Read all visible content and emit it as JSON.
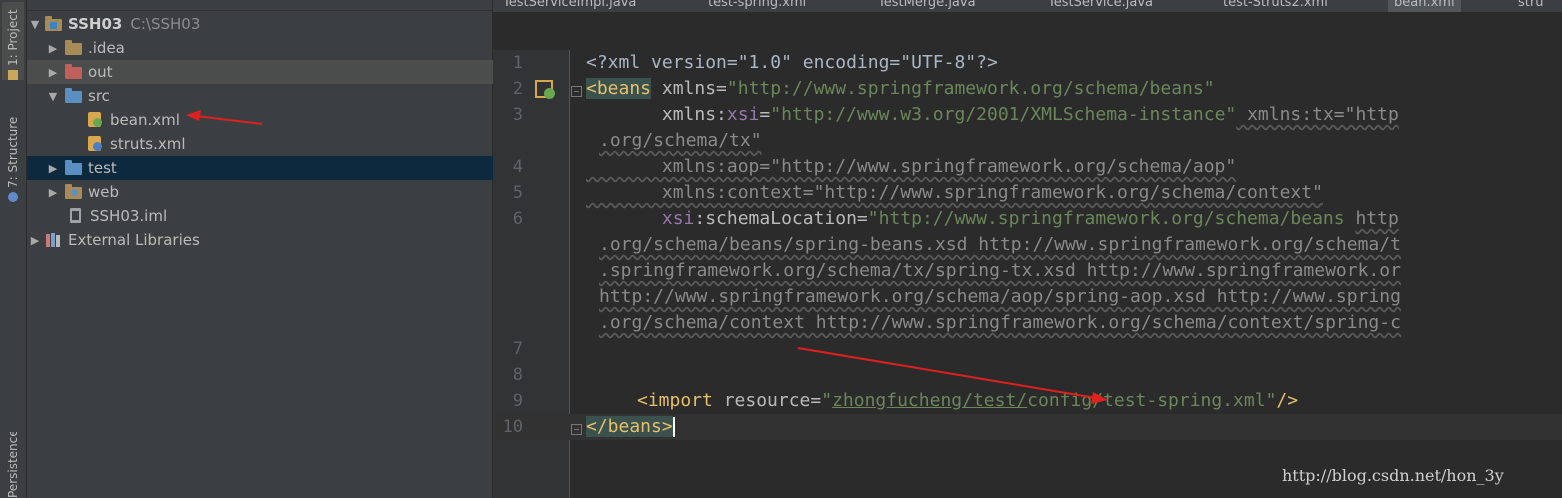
{
  "side_tabs": {
    "project": "1: Project",
    "structure": "7: Structure",
    "persistence": "Persistence"
  },
  "project_tree": [
    {
      "label": "SSH03",
      "path": "C:\\SSH03",
      "icon": "module-folder-icon",
      "expanded": true
    },
    {
      "label": ".idea",
      "icon": "folder-icon"
    },
    {
      "label": "out",
      "icon": "excluded-folder-icon"
    },
    {
      "label": "src",
      "icon": "source-folder-icon",
      "expanded": true
    },
    {
      "label": "bean.xml",
      "icon": "spring-xml-icon"
    },
    {
      "label": "struts.xml",
      "icon": "struts-xml-icon"
    },
    {
      "label": "test",
      "icon": "test-folder-icon"
    },
    {
      "label": "web",
      "icon": "web-folder-icon"
    },
    {
      "label": "SSH03.iml",
      "icon": "iml-file-icon"
    },
    {
      "label": "External Libraries",
      "icon": "libraries-icon"
    }
  ],
  "editor_tabs": [
    "TestServiceImpl.java",
    "test-spring.xml",
    "TestMerge.java",
    "TestService.java",
    "test-Struts2.xml",
    "bean.xml",
    "stru"
  ],
  "line_numbers": [
    "1",
    "2",
    "3",
    "4",
    "5",
    "6",
    "7",
    "8",
    "9",
    "10"
  ],
  "code": {
    "l1": "<?xml version=\"1.0\" encoding=\"UTF-8\"?>",
    "l2_tag": "<beans",
    "l2_attr": " xmlns=",
    "l2_val": "\"http://www.springframework.org/schema/beans\"",
    "l3_indent": "       xmlns:",
    "l3_ns": "xsi",
    "l3_eq": "=",
    "l3_val": "\"http://www.w3.org/2001/XMLSchema-instance\"",
    "l3_rest": " xmlns:tx=\"http",
    "l3_cont": ".org/schema/tx\"",
    "l4": "       xmlns:aop=\"http://www.springframework.org/schema/aop\"",
    "l5": "       xmlns:context=\"http://www.springframework.org/schema/context\"",
    "l6_ns": "xsi",
    "l6_attr": ":schemaLocation=",
    "l6_val": "\"http://www.springframework.org/schema/beans ",
    "l6_rest": "http",
    "l6_c1": ".org/schema/beans/spring-beans.xsd http://www.springframework.org/schema/t",
    "l6_c2": ".springframework.org/schema/tx/spring-tx.xsd http://www.springframework.or",
    "l6_c3": "http://www.springframework.org/schema/aop/spring-aop.xsd http://www.spring",
    "l6_c4": ".org/schema/context http://www.springframework.org/schema/context/spring-c",
    "l9_tag": "<import",
    "l9_attr": " resource=",
    "l9_q": "\"",
    "l9_v1": "zhongfucheng/test/",
    "l9_v2": "config/test-spring.xml",
    "l9_end": "/>",
    "l10": "</beans>"
  },
  "watermark": "http://blog.csdn.net/hon_3y",
  "colors": {
    "panel": "#3c3f41",
    "editor": "#2b2b2b",
    "selection": "#0d293e",
    "arrow": "#e0201e"
  }
}
